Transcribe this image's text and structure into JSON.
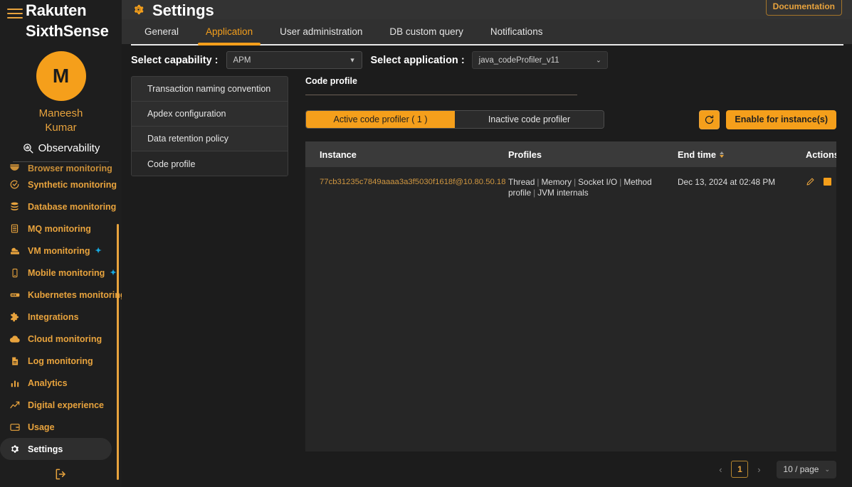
{
  "sidebar": {
    "brand_line1": "Rakuten",
    "brand_line2": "SixthSense",
    "avatar_initial": "M",
    "user_name_line1": "Maneesh",
    "user_name_line2": "Kumar",
    "section_label": "Observability",
    "items": [
      {
        "label": "Browser monitoring",
        "icon": "browser-icon",
        "ai": false,
        "active": false,
        "clipped": true
      },
      {
        "label": "Synthetic monitoring",
        "icon": "synthetic-icon",
        "ai": false,
        "active": false,
        "clipped": false
      },
      {
        "label": "Database monitoring",
        "icon": "database-icon",
        "ai": false,
        "active": false,
        "clipped": false
      },
      {
        "label": "MQ monitoring",
        "icon": "mq-icon",
        "ai": false,
        "active": false,
        "clipped": false
      },
      {
        "label": "VM monitoring",
        "icon": "vm-icon",
        "ai": true,
        "active": false,
        "clipped": false
      },
      {
        "label": "Mobile monitoring",
        "icon": "mobile-icon",
        "ai": true,
        "active": false,
        "clipped": false
      },
      {
        "label": "Kubernetes monitoring",
        "icon": "kubernetes-icon",
        "ai": true,
        "active": false,
        "clipped": false
      },
      {
        "label": "Integrations",
        "icon": "puzzle-icon",
        "ai": false,
        "active": false,
        "clipped": false
      },
      {
        "label": "Cloud monitoring",
        "icon": "cloud-icon",
        "ai": false,
        "active": false,
        "clipped": false
      },
      {
        "label": "Log monitoring",
        "icon": "log-icon",
        "ai": false,
        "active": false,
        "clipped": false
      },
      {
        "label": "Analytics",
        "icon": "analytics-icon",
        "ai": false,
        "active": false,
        "clipped": false
      },
      {
        "label": "Digital experience",
        "icon": "trend-icon",
        "ai": false,
        "active": false,
        "clipped": false
      },
      {
        "label": "Usage",
        "icon": "usage-icon",
        "ai": false,
        "active": false,
        "clipped": false
      },
      {
        "label": "Settings",
        "icon": "gear-icon",
        "ai": false,
        "active": true,
        "clipped": false
      }
    ],
    "logout_icon": "logout-icon"
  },
  "header": {
    "title": "Settings",
    "title_icon": "gear-icon",
    "documentation_label": "Documentation"
  },
  "tabs": [
    {
      "label": "General",
      "active": false
    },
    {
      "label": "Application",
      "active": true
    },
    {
      "label": "User administration",
      "active": false
    },
    {
      "label": "DB custom query",
      "active": false
    },
    {
      "label": "Notifications",
      "active": false
    }
  ],
  "selectors": {
    "capability_label": "Select capability :",
    "capability_value": "APM",
    "application_label": "Select application :",
    "application_value": "java_codeProfiler_v11"
  },
  "submenu": [
    {
      "label": "Transaction naming convention",
      "active": false
    },
    {
      "label": "Apdex configuration",
      "active": false
    },
    {
      "label": "Data retention policy",
      "active": false
    },
    {
      "label": "Code profile",
      "active": true
    }
  ],
  "panel": {
    "title": "Code profile",
    "toggle": [
      {
        "label": "Active code profiler ( 1 )",
        "active": true
      },
      {
        "label": "Inactive code profiler",
        "active": false
      }
    ],
    "refresh_icon": "refresh-icon",
    "enable_label": "Enable for instance(s)"
  },
  "table": {
    "columns": [
      "Instance",
      "Profiles",
      "End time",
      "Actions"
    ],
    "sort_column": "End time",
    "rows": [
      {
        "instance": "77cb31235c7849aaaa3a3f5030f1618f@10.80.50.18",
        "profiles": [
          "Thread",
          "Memory",
          "Socket I/O",
          "Method profile",
          "JVM internals"
        ],
        "end_time": "Dec 13, 2024 at 02:48 PM",
        "actions": [
          "edit-icon",
          "stop-icon"
        ]
      }
    ]
  },
  "pagination": {
    "prev": "‹",
    "page": "1",
    "next": "›",
    "page_size": "10 / page"
  },
  "colors": {
    "accent": "#f59f1b",
    "accent_text": "#e8a33d",
    "ai_badge": "#17a9e0",
    "panel_bg": "#262626",
    "sidebar_bg": "#1e1e1e"
  }
}
